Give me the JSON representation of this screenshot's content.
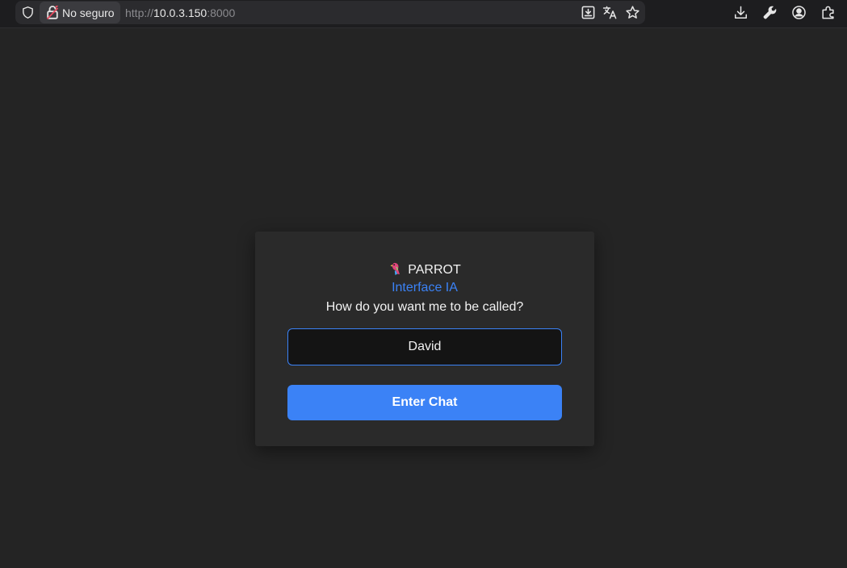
{
  "browser": {
    "security_label": "No seguro",
    "url_protocol": "http://",
    "url_host": "10.0.3.150",
    "url_port": ":8000",
    "icons": {
      "shield": "shield-icon",
      "lock": "unlocked-lock-icon",
      "install": "install-app-icon",
      "translate": "translate-icon",
      "bookmark": "star-icon",
      "downloads": "download-icon",
      "tools": "wrench-icon",
      "profile": "profile-icon",
      "extensions": "extensions-icon"
    }
  },
  "login": {
    "app_name": "PARROT",
    "subtitle": "Interface IA",
    "prompt": "How do you want me to be called?",
    "name_value": "David",
    "submit_label": "Enter Chat",
    "colors": {
      "accent": "#3b82f6",
      "card_bg": "#2a2a2a",
      "page_bg": "#242424",
      "input_bg": "#141414"
    }
  }
}
